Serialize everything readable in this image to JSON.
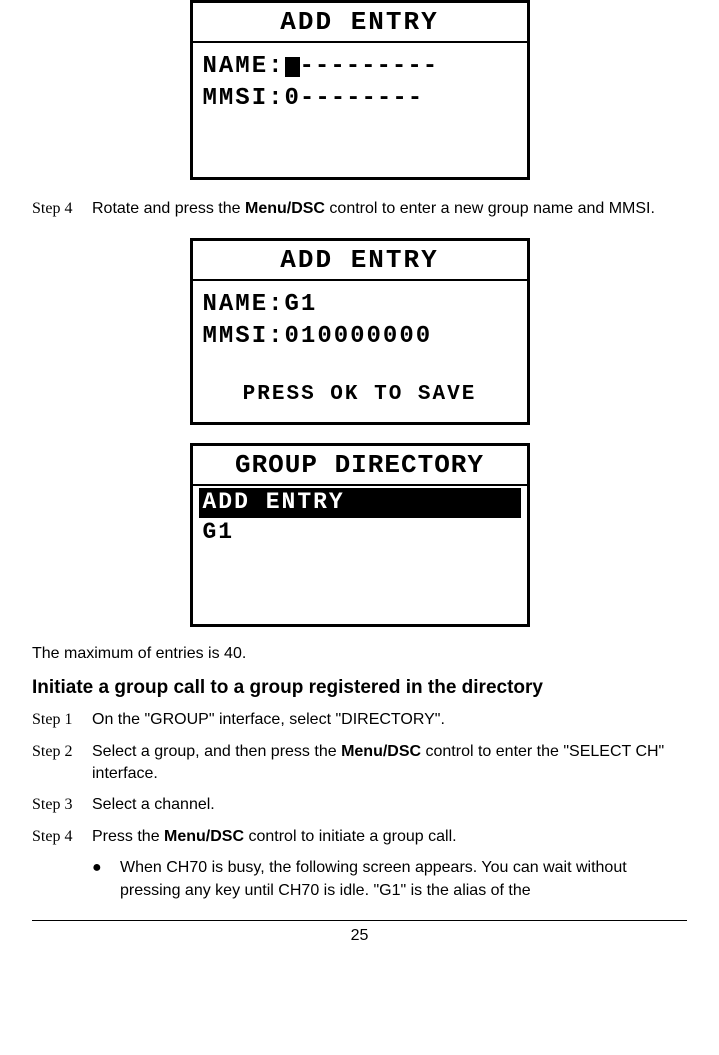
{
  "lcd1": {
    "title": "ADD ENTRY",
    "label_name": "NAME:",
    "name_rest": "---------",
    "label_mmsi": "MMSI:",
    "mmsi_value": "0--------"
  },
  "step4top": {
    "label": "Step 4",
    "text_before": "Rotate and press the ",
    "control": "Menu/DSC",
    "text_after": " control to enter a new group name and MMSI."
  },
  "lcd2": {
    "title": "ADD ENTRY",
    "label_name": "NAME:",
    "name_value": "G1",
    "label_mmsi": "MMSI:",
    "mmsi_value": "010000000",
    "footer": "PRESS OK TO SAVE"
  },
  "lcd3": {
    "title": "GROUP DIRECTORY",
    "selected": "ADD ENTRY",
    "item1": "G1"
  },
  "max_entries_note": "The maximum of entries is 40.",
  "section_title": "Initiate a group call to a group registered in the directory",
  "steps2": {
    "s1": {
      "label": "Step 1",
      "text": "On the \"GROUP\" interface, select \"DIRECTORY\"."
    },
    "s2": {
      "label": "Step 2",
      "before": "Select a group, and then press the ",
      "control": "Menu/DSC",
      "after": " control to enter the \"SELECT CH\" interface."
    },
    "s3": {
      "label": "Step 3",
      "text": "Select a channel."
    },
    "s4": {
      "label": "Step 4",
      "before": "Press the ",
      "control": "Menu/DSC",
      "after": " control to initiate a group call."
    }
  },
  "bullet1": "When CH70 is busy, the following screen appears. You can wait without pressing any key until CH70 is idle. \"G1\" is the alias of the",
  "page_number": "25"
}
